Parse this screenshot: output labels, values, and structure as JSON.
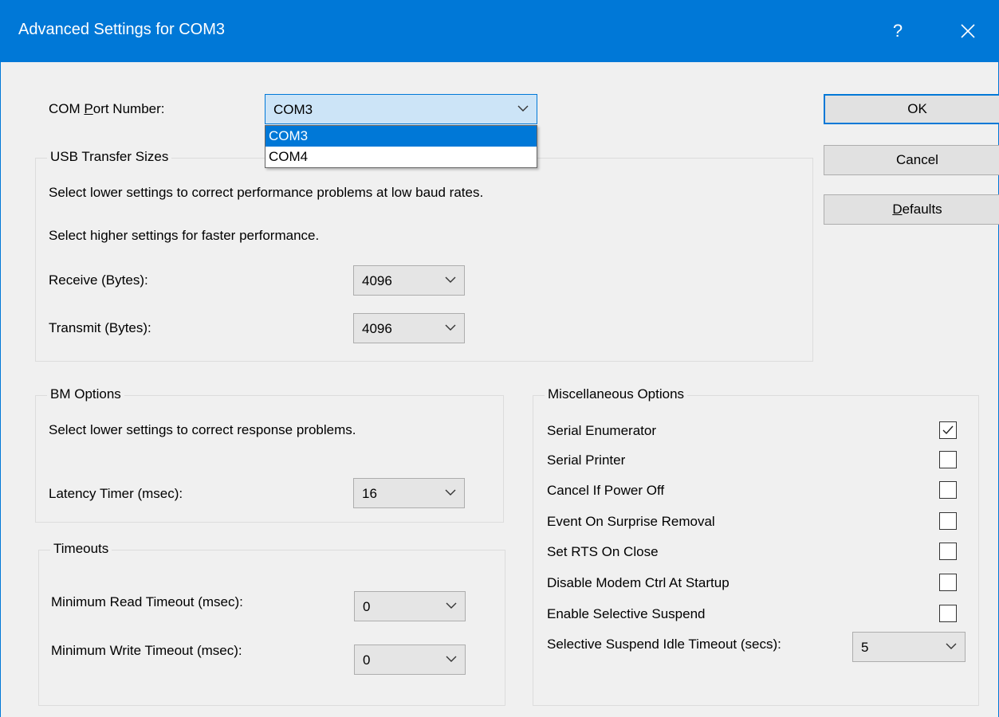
{
  "window": {
    "title": "Advanced Settings for COM3",
    "help_glyph": "?",
    "accent_color": "#0078d7"
  },
  "com_port": {
    "label_pre": "COM ",
    "label_mnemonic": "P",
    "label_post": "ort Number:",
    "value": "COM3",
    "options": [
      "COM3",
      "COM4"
    ],
    "highlighted_option": "COM3"
  },
  "buttons": {
    "ok": "OK",
    "cancel": "Cancel",
    "defaults_mnemonic": "D",
    "defaults_rest": "efaults"
  },
  "usb_transfer": {
    "legend": "USB Transfer Sizes",
    "hint_low": "Select lower settings to correct performance problems at low baud rates.",
    "hint_high": "Select higher settings for faster performance.",
    "receive_label": "Receive (Bytes):",
    "receive_value": "4096",
    "transmit_label": "Transmit (Bytes):",
    "transmit_value": "4096"
  },
  "bm_options": {
    "legend": "BM Options",
    "hint": "Select lower settings to correct response problems.",
    "latency_label": "Latency Timer (msec):",
    "latency_value": "16"
  },
  "timeouts": {
    "legend": "Timeouts",
    "min_read_label": "Minimum Read Timeout (msec):",
    "min_read_value": "0",
    "min_write_label": "Minimum Write Timeout (msec):",
    "min_write_value": "0"
  },
  "misc": {
    "legend": "Miscellaneous Options",
    "options": [
      {
        "label": "Serial Enumerator",
        "checked": true
      },
      {
        "label": "Serial Printer",
        "checked": false
      },
      {
        "label": "Cancel If Power Off",
        "checked": false
      },
      {
        "label": "Event On Surprise Removal",
        "checked": false
      },
      {
        "label": "Set RTS On Close",
        "checked": false
      },
      {
        "label": "Disable Modem Ctrl At Startup",
        "checked": false
      },
      {
        "label": "Enable Selective Suspend",
        "checked": false
      }
    ],
    "idle_timeout_label": "Selective Suspend Idle Timeout (secs):",
    "idle_timeout_value": "5"
  },
  "icons": {
    "close": "close-icon",
    "help": "help-icon",
    "chevron": "chevron-down-icon",
    "check": "checkmark-icon"
  }
}
